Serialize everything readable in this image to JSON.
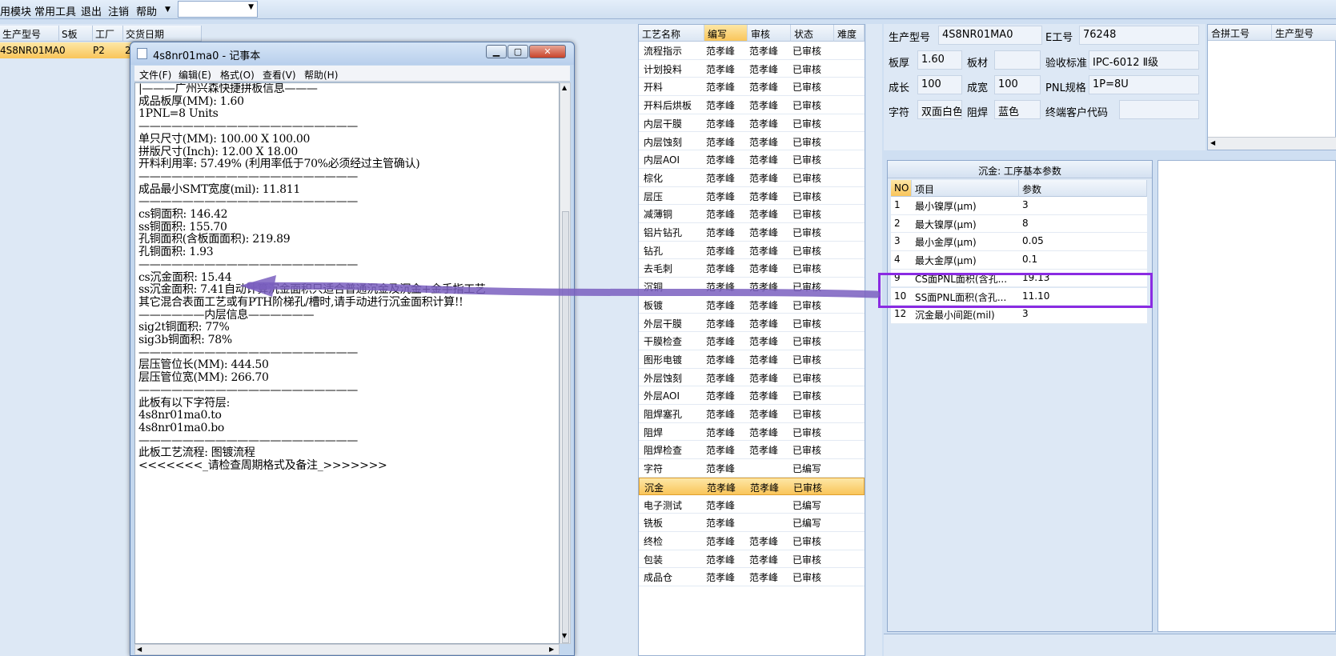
{
  "menubar": {
    "items": [
      "用模块",
      "常用工具",
      "退出",
      "注销",
      "帮助"
    ],
    "dropdown_icon": "triangle-down-icon"
  },
  "left_table": {
    "columns": [
      "生产型号",
      "S板",
      "工厂",
      "交货日期"
    ],
    "row": {
      "model": "4S8NR01MA0",
      "factory": "P2",
      "date_partial": "2"
    }
  },
  "notepad": {
    "title": "4s8nr01ma0 - 记事本",
    "menu": [
      "文件(F)",
      "编辑(E)",
      "格式(O)",
      "查看(V)",
      "帮助(H)"
    ],
    "text": "|———广州兴森快捷拼板信息———\n成品板厚(MM): 1.60\n1PNL=8 Units\n————————————————————\n单只尺寸(MM): 100.00 X 100.00\n拼版尺寸(Inch): 12.00 X 18.00\n开料利用率: 57.49% (利用率低于70%必须经过主管确认)\n————————————————————\n成品最小SMT宽度(mil): 11.811\n————————————————————\ncs铜面积: 146.42\nss铜面积: 155.70\n孔铜面积(含板面面积): 219.89\n孔铜面积: 1.93\n————————————————————\ncs沉金面积: 15.44\nss沉金面积: 7.41自动计算沉金面积只适合普通沉金及沉金+金手指工艺\n其它混合表面工艺或有PTH阶梯孔/槽时,请手动进行沉金面积计算!!\n——————内层信息——————\nsig2t铜面积: 77%\nsig3b铜面积: 78%\n————————————————————\n层压管位长(MM): 444.50\n层压管位宽(MM): 266.70\n————————————————————\n此板有以下字符层:\n4s8nr01ma0.to\n4s8nr01ma0.bo\n————————————————————\n此板工艺流程: 图镀流程\n<<<<<<<_请检查周期格式及备注_>>>>>>>"
  },
  "process_table": {
    "columns": [
      "工艺名称",
      "编写",
      "审核",
      "状态",
      "难度"
    ],
    "rows": [
      [
        "流程指示",
        "范孝峰",
        "范孝峰",
        "已审核"
      ],
      [
        "计划投料",
        "范孝峰",
        "范孝峰",
        "已审核"
      ],
      [
        "开料",
        "范孝峰",
        "范孝峰",
        "已审核"
      ],
      [
        "开料后烘板",
        "范孝峰",
        "范孝峰",
        "已审核"
      ],
      [
        "内层干膜",
        "范孝峰",
        "范孝峰",
        "已审核"
      ],
      [
        "内层蚀刻",
        "范孝峰",
        "范孝峰",
        "已审核"
      ],
      [
        "内层AOI",
        "范孝峰",
        "范孝峰",
        "已审核"
      ],
      [
        "棕化",
        "范孝峰",
        "范孝峰",
        "已审核"
      ],
      [
        "层压",
        "范孝峰",
        "范孝峰",
        "已审核"
      ],
      [
        "减薄铜",
        "范孝峰",
        "范孝峰",
        "已审核"
      ],
      [
        "铝片钻孔",
        "范孝峰",
        "范孝峰",
        "已审核"
      ],
      [
        "钻孔",
        "范孝峰",
        "范孝峰",
        "已审核"
      ],
      [
        "去毛刺",
        "范孝峰",
        "范孝峰",
        "已审核"
      ],
      [
        "沉铜",
        "范孝峰",
        "范孝峰",
        "已审核"
      ],
      [
        "板镀",
        "范孝峰",
        "范孝峰",
        "已审核"
      ],
      [
        "外层干膜",
        "范孝峰",
        "范孝峰",
        "已审核"
      ],
      [
        "干膜检查",
        "范孝峰",
        "范孝峰",
        "已审核"
      ],
      [
        "图形电镀",
        "范孝峰",
        "范孝峰",
        "已审核"
      ],
      [
        "外层蚀刻",
        "范孝峰",
        "范孝峰",
        "已审核"
      ],
      [
        "外层AOI",
        "范孝峰",
        "范孝峰",
        "已审核"
      ],
      [
        "阻焊塞孔",
        "范孝峰",
        "范孝峰",
        "已审核"
      ],
      [
        "阻焊",
        "范孝峰",
        "范孝峰",
        "已审核"
      ],
      [
        "阻焊检查",
        "范孝峰",
        "范孝峰",
        "已审核"
      ],
      [
        "字符",
        "范孝峰",
        "",
        "已编写"
      ],
      [
        "沉金",
        "范孝峰",
        "范孝峰",
        "已审核"
      ],
      [
        "电子测试",
        "范孝峰",
        "",
        "已编写"
      ],
      [
        "铣板",
        "范孝峰",
        "",
        "已编写"
      ],
      [
        "终检",
        "范孝峰",
        "范孝峰",
        "已审核"
      ],
      [
        "包装",
        "范孝峰",
        "范孝峰",
        "已审核"
      ],
      [
        "成品仓",
        "范孝峰",
        "范孝峰",
        "已审核"
      ]
    ]
  },
  "info": {
    "model_label": "生产型号",
    "model": "4S8NR01MA0",
    "eno_label": "E工号",
    "eno": "76248",
    "thick_label": "板厚",
    "thick": "1.60",
    "material_label": "板材",
    "material": "",
    "standard_label": "验收标准",
    "standard": "IPC-6012 Ⅱ级",
    "length_label": "成长",
    "length": "100",
    "width_label": "成宽",
    "width": "100",
    "pnl_label": "PNL规格",
    "pnl": "1P=8U",
    "char_label": "字符",
    "char": "双面白色",
    "mask_label": "阻焊",
    "mask": "蓝色",
    "customer_label": "终端客户代码",
    "customer": ""
  },
  "merge_table": {
    "columns": [
      "合拼工号",
      "生产型号"
    ]
  },
  "param_panel": {
    "title": "沉金: 工序基本参数",
    "columns": [
      "NO",
      "项目",
      "参数"
    ],
    "rows": [
      [
        "1",
        "最小镍厚(μm)",
        "3"
      ],
      [
        "2",
        "最大镍厚(μm)",
        "8"
      ],
      [
        "3",
        "最小金厚(μm)",
        "0.05"
      ],
      [
        "4",
        "最大金厚(μm)",
        "0.1"
      ],
      [
        "9",
        "CS面PNL面积(含孔...",
        "19.13"
      ],
      [
        "10",
        "SS面PNL面积(含孔...",
        "11.10"
      ],
      [
        "12",
        "沉金最小间距(mil)",
        "3"
      ]
    ]
  },
  "colors": {
    "highlight": "#8a2be2",
    "arrow": "#7a5fc0",
    "selected_row": "#f9c55a"
  }
}
